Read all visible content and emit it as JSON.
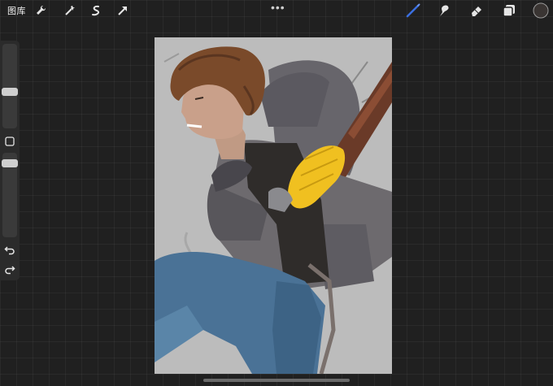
{
  "topbar": {
    "gallery_label": "图库",
    "tools_left": [
      "wrench-icon",
      "magic-wand-icon",
      "selection-icon",
      "transform-arrow-icon"
    ],
    "more_label": "•••",
    "tools_right": [
      "brush-icon",
      "smudge-icon",
      "eraser-icon",
      "layers-icon"
    ],
    "active_tool": "brush",
    "accent_color": "#3b6fe0",
    "current_color": "#3a3533"
  },
  "sidebar": {
    "brush_size": 0.4,
    "opacity": 1.0,
    "icons": [
      "modify-square-icon",
      "undo-icon",
      "redo-icon"
    ]
  },
  "canvas": {
    "content": "illustration",
    "colors": {
      "background": "#bcbcbc",
      "hair": "#7a4a2a",
      "skin": "#c9a08a",
      "jacket": "#6d6a6e",
      "shirt": "#2f2c2a",
      "gloves": "#f0c020",
      "jeans": "#4a7296",
      "bat": "#6a3a28"
    }
  }
}
